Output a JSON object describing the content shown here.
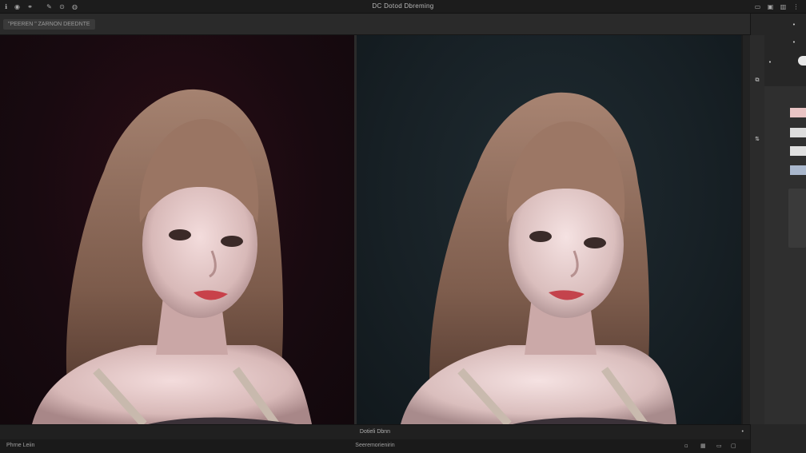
{
  "window": {
    "title": "DC Dotod Dbreming",
    "toolbar_icons": [
      "info-icon",
      "circle-icon",
      "link-icon",
      "brush-icon",
      "stamp-icon",
      "eye-icon"
    ]
  },
  "options_bar": {
    "document_tab": "\"PEEREN \" ZARNON DEEDNTE"
  },
  "canvas": {
    "left_panel": {
      "background": "#1e0b12",
      "hair_color": "#8a6654",
      "lip_color": "#c8414a"
    },
    "right_panel": {
      "background": "#1c262b",
      "hair_color": "#8c6756",
      "lip_color": "#c4434c"
    }
  },
  "status_bar": {
    "center_label": "Dotieli Dbnn",
    "close_glyph": "•"
  },
  "bottom_bar": {
    "left_label": "Phrne Leiin",
    "center_label": "Seeremorienirin"
  },
  "side_panel": {
    "swatches": [
      "#e9c4c4",
      "#dddddd",
      "#e0e0e0",
      "#a9b7cc"
    ]
  }
}
